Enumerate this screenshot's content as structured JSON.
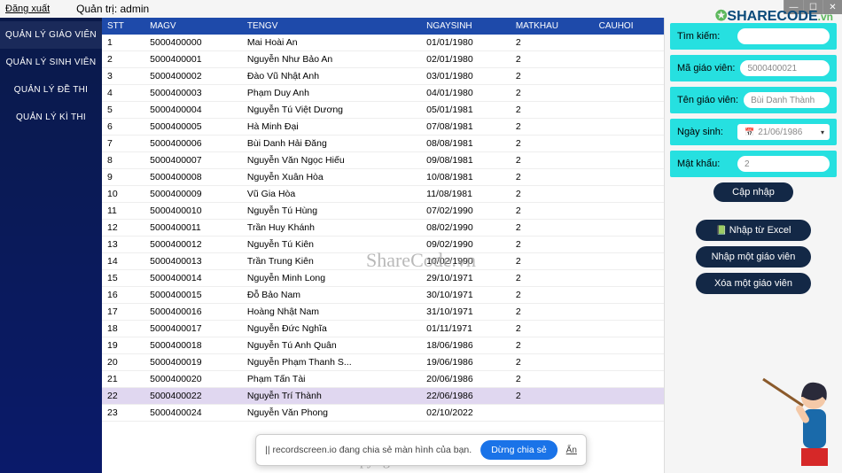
{
  "top": {
    "logout": "Đăng xuất",
    "admin_label": "Quản trị:  admin"
  },
  "sidebar": {
    "items": [
      {
        "label": "QUẢN LÝ GIÁO VIÊN",
        "active": true
      },
      {
        "label": "QUẢN LÝ SINH VIÊN",
        "active": false
      },
      {
        "label": "QUẢN LÝ ĐỀ THI",
        "active": false
      },
      {
        "label": "QUẢN LÝ KÌ THI",
        "active": false
      }
    ]
  },
  "table": {
    "headers": [
      "STT",
      "MAGV",
      "TENGV",
      "NGAYSINH",
      "MATKHAU",
      "CAUHOI"
    ],
    "rows": [
      {
        "stt": "1",
        "magv": "5000400000",
        "tengv": "Mai Hoài An",
        "ns": "01/01/1980",
        "mk": "2",
        "ch": ""
      },
      {
        "stt": "2",
        "magv": "5000400001",
        "tengv": "Nguyễn Như Bảo An",
        "ns": "02/01/1980",
        "mk": "2",
        "ch": ""
      },
      {
        "stt": "3",
        "magv": "5000400002",
        "tengv": "Đào Vũ Nhật Anh",
        "ns": "03/01/1980",
        "mk": "2",
        "ch": ""
      },
      {
        "stt": "4",
        "magv": "5000400003",
        "tengv": "Phạm Duy Anh",
        "ns": "04/01/1980",
        "mk": "2",
        "ch": ""
      },
      {
        "stt": "5",
        "magv": "5000400004",
        "tengv": "Nguyễn Tú Việt Dương",
        "ns": "05/01/1981",
        "mk": "2",
        "ch": ""
      },
      {
        "stt": "6",
        "magv": "5000400005",
        "tengv": "Hà Minh Đại",
        "ns": "07/08/1981",
        "mk": "2",
        "ch": ""
      },
      {
        "stt": "7",
        "magv": "5000400006",
        "tengv": "Bùi Danh Hải Đăng",
        "ns": "08/08/1981",
        "mk": "2",
        "ch": ""
      },
      {
        "stt": "8",
        "magv": "5000400007",
        "tengv": "Nguyễn Văn Ngọc Hiếu",
        "ns": "09/08/1981",
        "mk": "2",
        "ch": ""
      },
      {
        "stt": "9",
        "magv": "5000400008",
        "tengv": "Nguyễn Xuân Hòa",
        "ns": "10/08/1981",
        "mk": "2",
        "ch": ""
      },
      {
        "stt": "10",
        "magv": "5000400009",
        "tengv": "Vũ Gia Hòa",
        "ns": "11/08/1981",
        "mk": "2",
        "ch": ""
      },
      {
        "stt": "11",
        "magv": "5000400010",
        "tengv": "Nguyễn Tú Hùng",
        "ns": "07/02/1990",
        "mk": "2",
        "ch": ""
      },
      {
        "stt": "12",
        "magv": "5000400011",
        "tengv": "Trần Huy Khánh",
        "ns": "08/02/1990",
        "mk": "2",
        "ch": ""
      },
      {
        "stt": "13",
        "magv": "5000400012",
        "tengv": "Nguyễn Tú Kiên",
        "ns": "09/02/1990",
        "mk": "2",
        "ch": ""
      },
      {
        "stt": "14",
        "magv": "5000400013",
        "tengv": "Trần Trung Kiên",
        "ns": "10/02/1990",
        "mk": "2",
        "ch": ""
      },
      {
        "stt": "15",
        "magv": "5000400014",
        "tengv": "Nguyễn Minh Long",
        "ns": "29/10/1971",
        "mk": "2",
        "ch": ""
      },
      {
        "stt": "16",
        "magv": "5000400015",
        "tengv": "Đỗ Bảo Nam",
        "ns": "30/10/1971",
        "mk": "2",
        "ch": ""
      },
      {
        "stt": "17",
        "magv": "5000400016",
        "tengv": "Hoàng Nhật Nam",
        "ns": "31/10/1971",
        "mk": "2",
        "ch": ""
      },
      {
        "stt": "18",
        "magv": "5000400017",
        "tengv": "Nguyễn Đức Nghĩa",
        "ns": "01/11/1971",
        "mk": "2",
        "ch": ""
      },
      {
        "stt": "19",
        "magv": "5000400018",
        "tengv": "Nguyễn Tú Anh Quân",
        "ns": "18/06/1986",
        "mk": "2",
        "ch": ""
      },
      {
        "stt": "20",
        "magv": "5000400019",
        "tengv": "Nguyễn Phạm Thanh S...",
        "ns": "19/06/1986",
        "mk": "2",
        "ch": ""
      },
      {
        "stt": "21",
        "magv": "5000400020",
        "tengv": "Phạm Tấn Tài",
        "ns": "20/06/1986",
        "mk": "2",
        "ch": ""
      },
      {
        "stt": "22",
        "magv": "5000400022",
        "tengv": "Nguyễn Trí Thành",
        "ns": "22/06/1986",
        "mk": "2",
        "ch": "",
        "selected": true
      },
      {
        "stt": "23",
        "magv": "5000400024",
        "tengv": "Nguyễn Văn Phong",
        "ns": "02/10/2022",
        "mk": "",
        "ch": ""
      }
    ]
  },
  "form": {
    "search_label": "Tìm kiếm:",
    "search_value": "",
    "magv_label": "Mã giáo viên:",
    "magv_value": "5000400021",
    "tengv_label": "Tên giáo viên:",
    "tengv_value": "Bùi Danh Thành",
    "ns_label": "Ngày sinh:",
    "ns_value": "21/06/1986",
    "mk_label": "Mật khẩu:",
    "mk_value": "2"
  },
  "buttons": {
    "update": "Cập nhập",
    "import_excel": "Nhập từ Excel",
    "add_one": "Nhập một giáo viên",
    "del_one": "Xóa một giáo viên"
  },
  "toast": {
    "text": "recordscreen.io đang chia sẻ màn hình của bạn.",
    "stop": "Dừng chia sẻ",
    "hide": "Ẩn"
  },
  "watermarks": {
    "brand": "SHARECODE",
    "brand_suffix": ".vn",
    "center1": "ShareCode.vn",
    "center2": "Copyright © ShareCode.vn"
  }
}
